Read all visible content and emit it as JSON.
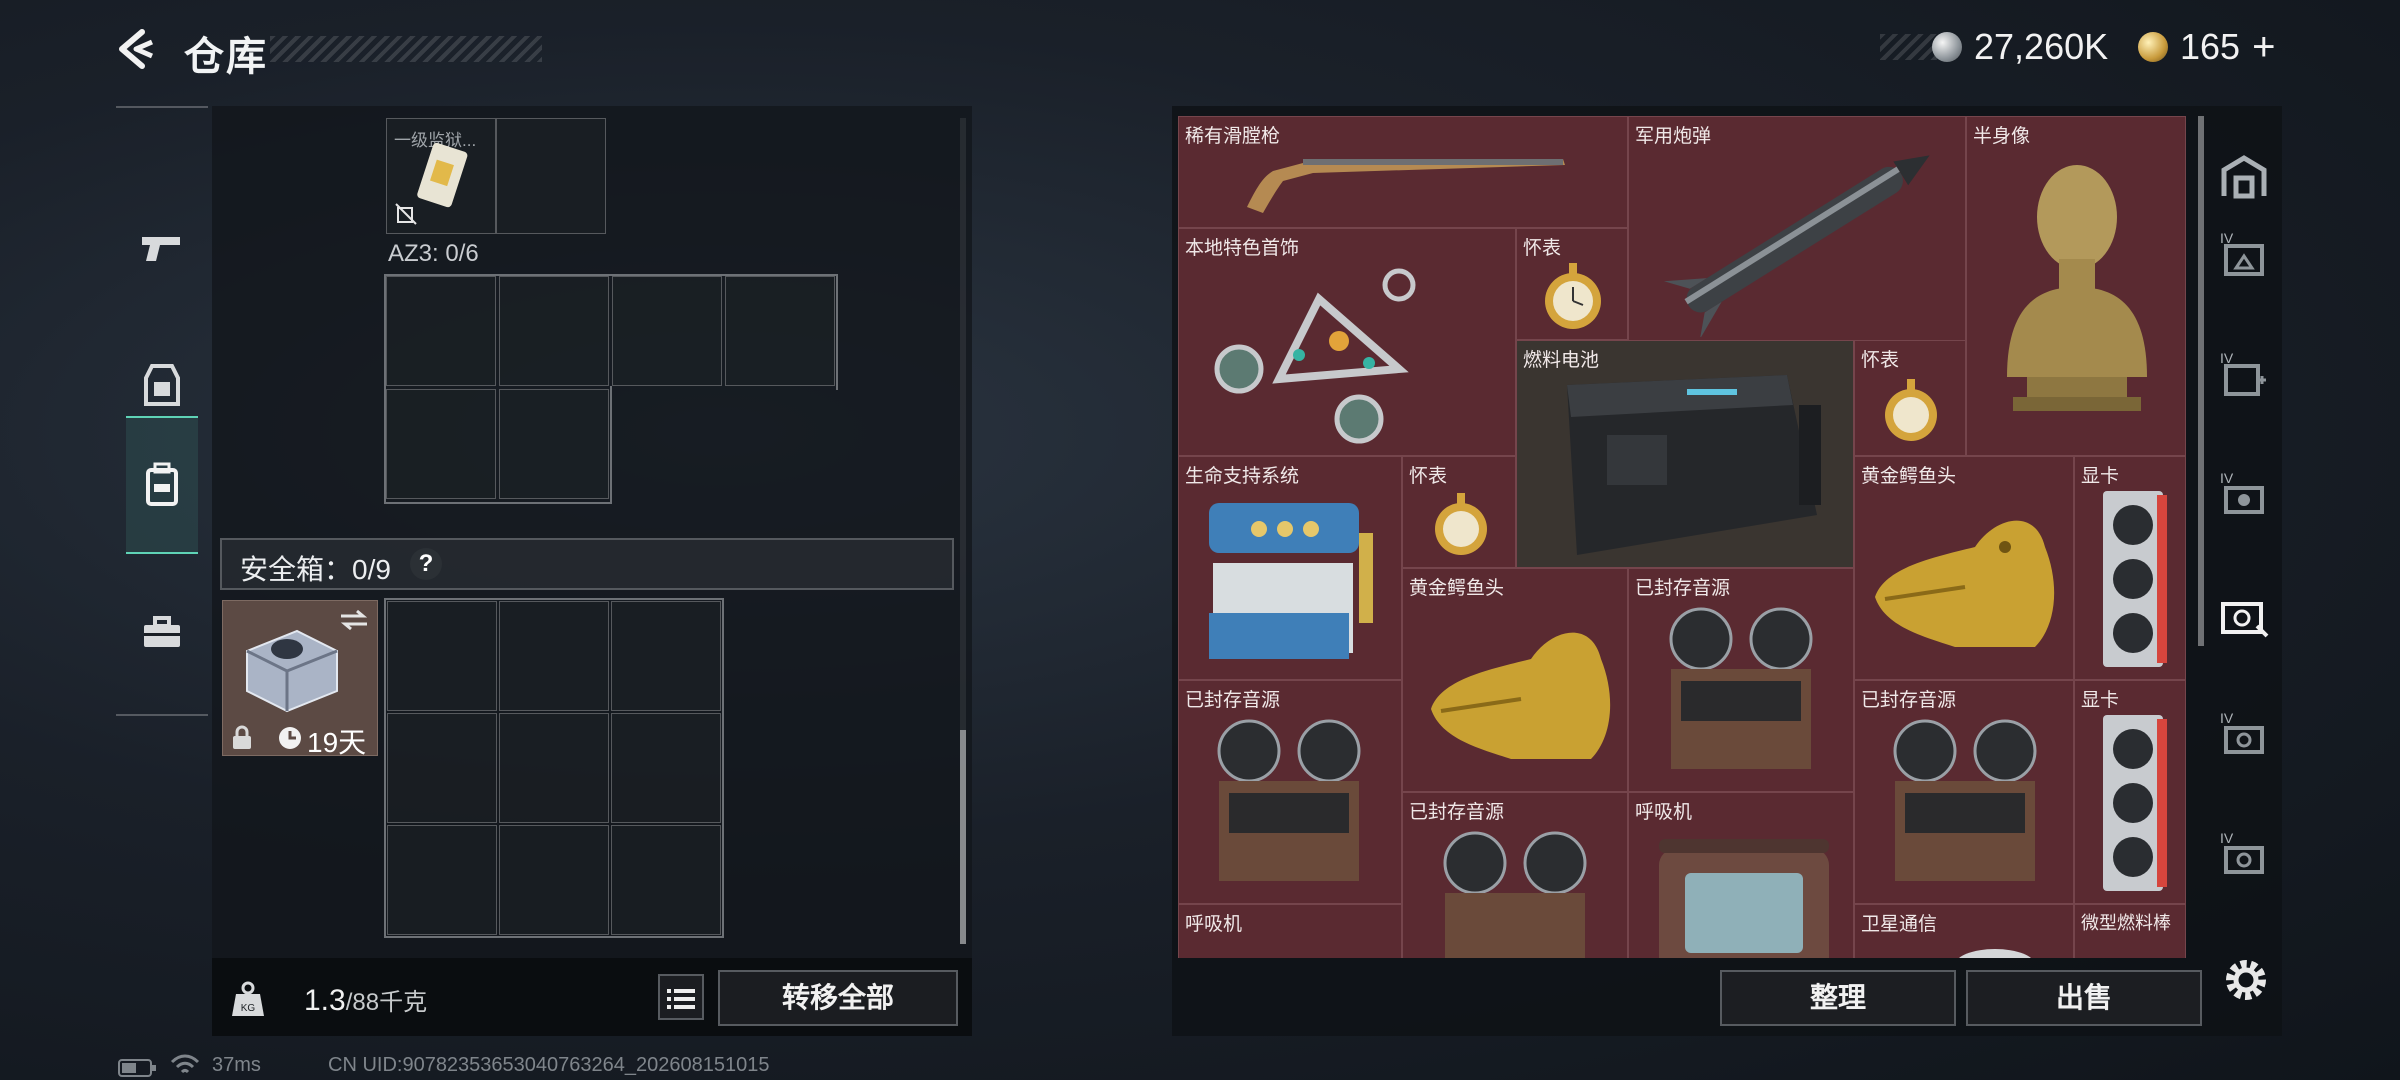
{
  "header": {
    "title": "仓库",
    "currency_1": "27,260K",
    "currency_2": "165",
    "currency_2_plus": "+"
  },
  "sidebar": {
    "tabs": [
      {
        "icon": "pistol-icon",
        "active": false
      },
      {
        "icon": "armor-vest-icon",
        "active": false
      },
      {
        "icon": "backpack-icon",
        "active": true
      },
      {
        "icon": "toolbox-icon",
        "active": false
      }
    ]
  },
  "left": {
    "top_item_label": "一级监狱...",
    "az3_label": "AZ3: 0/6",
    "safebox_label": "安全箱：0/9",
    "help": "?",
    "safe_item_timer": "19天",
    "weight_value": "1.3",
    "weight_max": "/88千克",
    "transfer_all": "转移全部"
  },
  "inventory": {
    "items": [
      {
        "label": "稀有滑膛枪",
        "icon": "musket-icon"
      },
      {
        "label": "军用炮弹",
        "icon": "missile-icon"
      },
      {
        "label": "半身像",
        "icon": "bust-statue-icon"
      },
      {
        "label": "本地特色首饰",
        "icon": "jewelry-icon"
      },
      {
        "label": "怀表",
        "icon": "pocket-watch-icon"
      },
      {
        "label": "燃料电池",
        "icon": "fuel-cell-icon"
      },
      {
        "label": "怀表",
        "icon": "pocket-watch-icon"
      },
      {
        "label": "生命支持系统",
        "icon": "life-support-icon"
      },
      {
        "label": "怀表",
        "icon": "pocket-watch-icon"
      },
      {
        "label": "黄金鳄鱼头",
        "icon": "gold-croc-head-icon"
      },
      {
        "label": "显卡",
        "icon": "gpu-icon"
      },
      {
        "label": "黄金鳄鱼头",
        "icon": "gold-croc-head-icon"
      },
      {
        "label": "已封存音源",
        "icon": "tape-recorder-icon"
      },
      {
        "label": "已封存音源",
        "icon": "tape-recorder-icon"
      },
      {
        "label": "已封存音源",
        "icon": "tape-recorder-icon"
      },
      {
        "label": "显卡",
        "icon": "gpu-icon"
      },
      {
        "label": "已封存音源",
        "icon": "tape-recorder-icon"
      },
      {
        "label": "呼吸机",
        "icon": "ventilator-icon"
      },
      {
        "label": "呼吸机",
        "icon": "ventilator-icon"
      },
      {
        "label": "卫星通信",
        "icon": "satellite-icon"
      },
      {
        "label": "微型燃料棒",
        "icon": "fuel-rod-icon"
      }
    ],
    "sort_button": "整理",
    "sell_button": "出售"
  },
  "status_bar": {
    "ping": "37ms",
    "uid": "CN UID:90782353653040763264_202608151015"
  },
  "colors": {
    "inventory_bg": "#5a2a31",
    "active_tab": "#5fd3b6"
  }
}
